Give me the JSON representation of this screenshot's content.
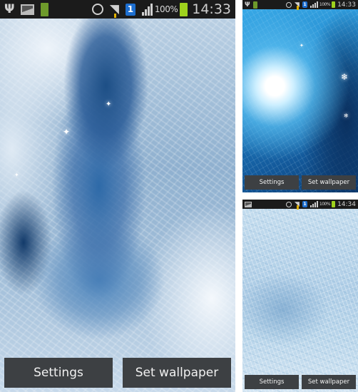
{
  "screens": [
    {
      "id": "main",
      "statusbar": {
        "left_icons": [
          "usb-icon",
          "image-icon",
          "battery-notification-icon"
        ],
        "battery_notification_text": "100%",
        "right_icons": [
          "alarm-icon",
          "wifi-icon",
          "sim-icon",
          "signal-icon",
          "battery-icon"
        ],
        "sim_label": "1",
        "battery_percent": "100%",
        "time": "14:33"
      },
      "wallpaper": "frost-crystals-heart",
      "buttons": {
        "settings": "Settings",
        "set_wallpaper": "Set wallpaper"
      }
    },
    {
      "id": "sun",
      "statusbar": {
        "left_icons": [
          "usb-icon",
          "battery-notification-icon"
        ],
        "right_icons": [
          "alarm-icon",
          "wifi-icon",
          "sim-icon",
          "signal-icon",
          "battery-icon"
        ],
        "sim_label": "1",
        "battery_percent": "100%",
        "time": "14:33"
      },
      "wallpaper": "frost-sunburst",
      "buttons": {
        "settings": "Settings",
        "set_wallpaper": "Set wallpaper"
      }
    },
    {
      "id": "ice",
      "statusbar": {
        "left_icons": [
          "image-icon"
        ],
        "right_icons": [
          "alarm-icon",
          "wifi-icon",
          "sim-icon",
          "signal-icon",
          "battery-icon"
        ],
        "sim_label": "1",
        "battery_percent": "100%",
        "time": "14:34"
      },
      "wallpaper": "frost-ice-texture",
      "buttons": {
        "settings": "Settings",
        "set_wallpaper": "Set wallpaper"
      }
    }
  ],
  "colors": {
    "statusbar_bg": "#1b1b1b",
    "button_bg": "#3d4043",
    "button_text": "#f1f1f1",
    "battery_green": "#9ed21d",
    "sim_blue": "#1e6fd0"
  }
}
